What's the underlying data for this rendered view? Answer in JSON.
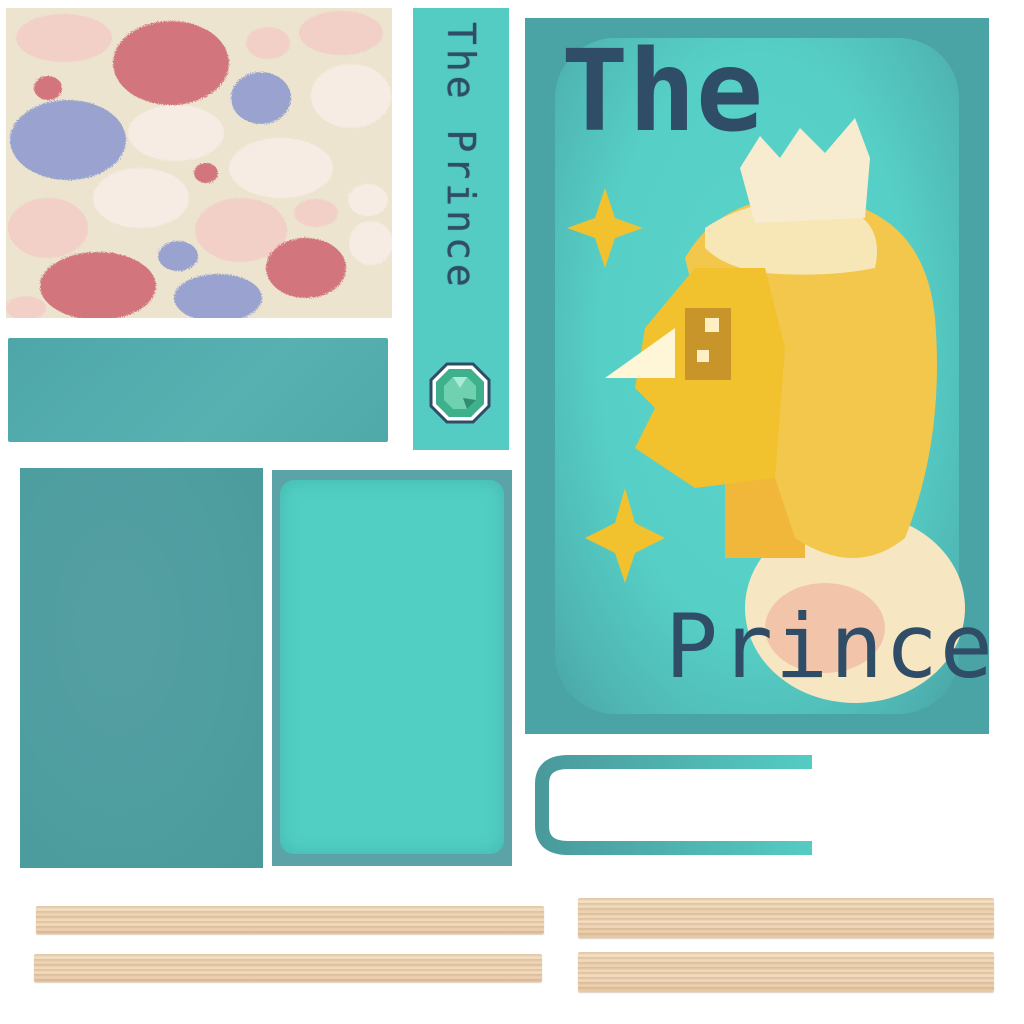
{
  "cover": {
    "title_line1": "The",
    "title_line2": "Prince"
  },
  "spine": {
    "title": "The Prince",
    "gem_icon": "emerald-gem-icon"
  },
  "colors": {
    "teal_dark": "#4aa3a5",
    "teal_light": "#54ccc3",
    "ink": "#2f4d66",
    "gold": "#f2c12e",
    "cream": "#ece4cf",
    "rose": "#d2757b",
    "lavender": "#9aa2cf",
    "wood": "#ecd2b0"
  }
}
